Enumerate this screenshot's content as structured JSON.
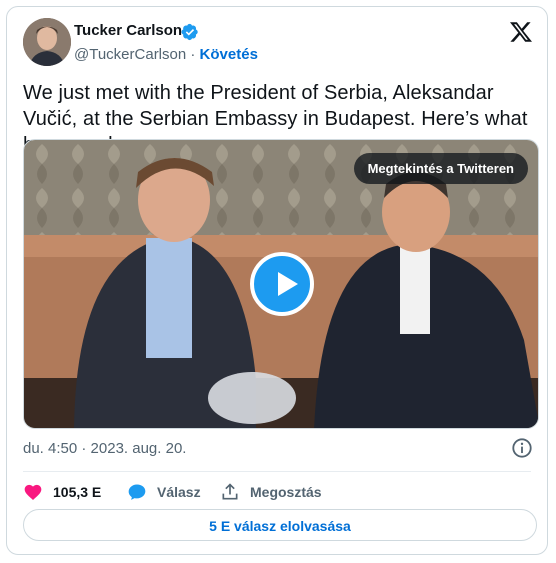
{
  "author": {
    "name": "Tucker Carlson",
    "handle": "@TuckerCarlson",
    "separator": "·",
    "follow_label": "Követés"
  },
  "tweet": {
    "text": "We just met with the President of Serbia, Aleksandar Vučić, at the Serbian Embassy in Budapest. Here’s what happened."
  },
  "media": {
    "watch_label": "Megtekintés a Twitteren"
  },
  "meta": {
    "timestamp": "du. 4:50 · 2023. aug. 20."
  },
  "actions": {
    "likes": "105,3 E",
    "reply_label": "Válasz",
    "share_label": "Megosztás"
  },
  "footer": {
    "read_replies_label": "5 E válasz elolvasása"
  },
  "colors": {
    "accent": "#1d9bf0",
    "link": "#006fd6",
    "like": "#f91880"
  }
}
